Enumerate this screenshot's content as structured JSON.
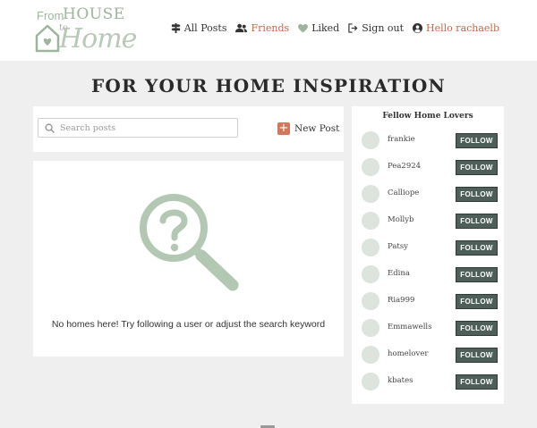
{
  "logo": {
    "from": "From",
    "house": "HOUSE",
    "to": "to",
    "home": "Home"
  },
  "nav": {
    "all_posts": "All Posts",
    "friends": "Friends",
    "liked": "Liked",
    "sign_out": "Sign out",
    "hello": "Hello rachaelb"
  },
  "page_title": "FOR YOUR HOME INSPIRATION",
  "search": {
    "placeholder": "Search posts",
    "value": ""
  },
  "new_post_label": "New Post",
  "empty_message": "No homes here! Try following a user or adjust the search keyword",
  "sidebar": {
    "title": "Fellow Home Lovers",
    "follow_label": "FOLLOW",
    "users": [
      {
        "name": "frankie"
      },
      {
        "name": "Pea2924"
      },
      {
        "name": "Calliope"
      },
      {
        "name": "Mollyb"
      },
      {
        "name": "Patsy"
      },
      {
        "name": "Edina"
      },
      {
        "name": "Ria999"
      },
      {
        "name": "Emmawells"
      },
      {
        "name": "homelover"
      },
      {
        "name": "kbates"
      }
    ]
  },
  "colors": {
    "accent": "#c3694a",
    "sage": "#9db59d",
    "follow_button": "#4e5f5a",
    "background": "#efefef"
  },
  "icons": {
    "all_posts": "signpost-icon",
    "friends": "users-icon",
    "liked": "heart-icon",
    "sign_out": "sign-out-icon",
    "hello": "user-circle-icon",
    "search": "search-icon",
    "new_post": "plus-icon",
    "empty_state": "magnifier-question-icon"
  }
}
